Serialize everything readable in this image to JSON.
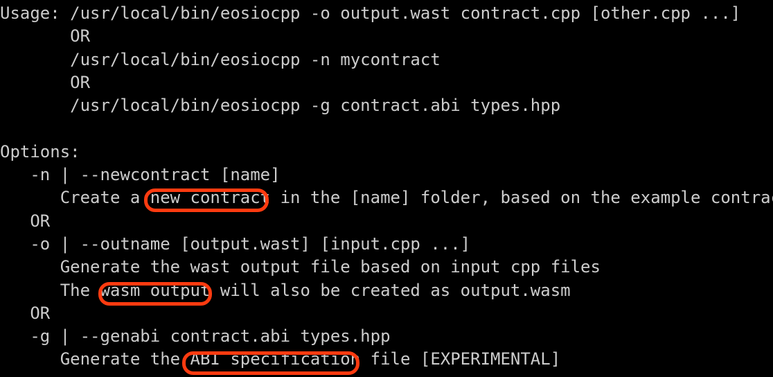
{
  "terminal": {
    "background_color": "#000000",
    "text_color": "#cccccc",
    "annotation_color": "#ff3b10",
    "lines": [
      "Usage: /usr/local/bin/eosiocpp -o output.wast contract.cpp [other.cpp ...]",
      "       OR",
      "       /usr/local/bin/eosiocpp -n mycontract",
      "       OR",
      "       /usr/local/bin/eosiocpp -g contract.abi types.hpp",
      "",
      "Options:",
      "   -n | --newcontract [name]",
      "      Create a new contract in the [name] folder, based on the example contract",
      "   OR",
      "   -o | --outname [output.wast] [input.cpp ...]",
      "      Generate the wast output file based on input cpp files",
      "      The wasm output will also be created as output.wasm",
      "   OR",
      "   -g | --genabi contract.abi types.hpp",
      "      Generate the ABI specification file [EXPERIMENTAL]"
    ]
  },
  "annotations": [
    {
      "id": "new-contract",
      "text": "new contract"
    },
    {
      "id": "wasm-output",
      "text": "wasm output"
    },
    {
      "id": "abi-specification",
      "text": "ABI specification"
    }
  ]
}
